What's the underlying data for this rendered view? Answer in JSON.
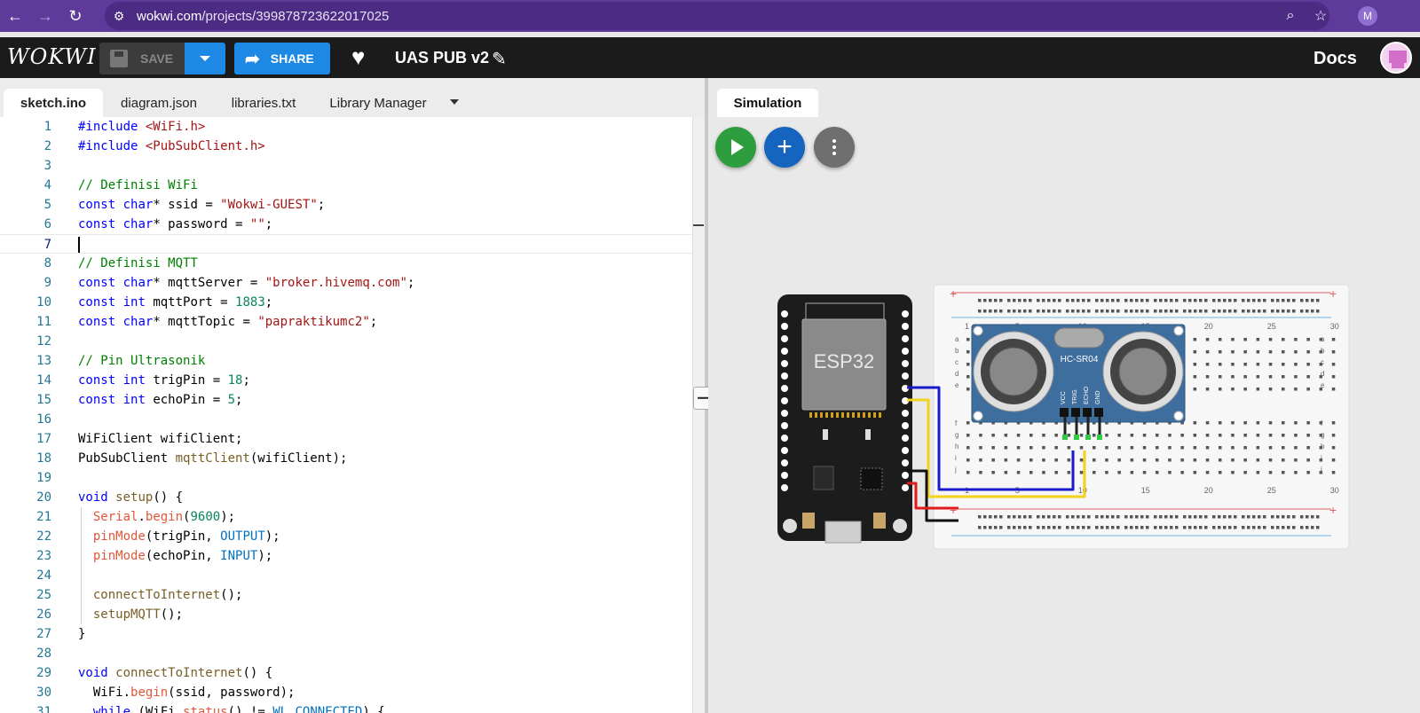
{
  "browser": {
    "url_host": "wokwi.com",
    "url_path": "/projects/399878723622017025",
    "profile_initial": "M"
  },
  "toolbar": {
    "logo": "WOKWI",
    "save_label": "SAVE",
    "share_label": "SHARE",
    "project_title": "UAS PUB v2",
    "docs_label": "Docs"
  },
  "editor": {
    "tabs": [
      {
        "label": "sketch.ino",
        "active": true
      },
      {
        "label": "diagram.json",
        "active": false
      },
      {
        "label": "libraries.txt",
        "active": false
      },
      {
        "label": "Library Manager",
        "active": false
      }
    ],
    "cursor_line": 7,
    "lines": [
      {
        "n": "1",
        "text": "#include <WiFi.h>"
      },
      {
        "n": "2",
        "text": "#include <PubSubClient.h>"
      },
      {
        "n": "3",
        "text": ""
      },
      {
        "n": "4",
        "text": "// Definisi WiFi"
      },
      {
        "n": "5",
        "text": "const char* ssid = \"Wokwi-GUEST\";"
      },
      {
        "n": "6",
        "text": "const char* password = \"\";"
      },
      {
        "n": "7",
        "text": ""
      },
      {
        "n": "8",
        "text": "// Definisi MQTT"
      },
      {
        "n": "9",
        "text": "const char* mqttServer = \"broker.hivemq.com\";"
      },
      {
        "n": "10",
        "text": "const int mqttPort = 1883;"
      },
      {
        "n": "11",
        "text": "const char* mqttTopic = \"papraktikumc2\";"
      },
      {
        "n": "12",
        "text": ""
      },
      {
        "n": "13",
        "text": "// Pin Ultrasonik"
      },
      {
        "n": "14",
        "text": "const int trigPin = 18;"
      },
      {
        "n": "15",
        "text": "const int echoPin = 5;"
      },
      {
        "n": "16",
        "text": ""
      },
      {
        "n": "17",
        "text": "WiFiClient wifiClient;"
      },
      {
        "n": "18",
        "text": "PubSubClient mqttClient(wifiClient);"
      },
      {
        "n": "19",
        "text": ""
      },
      {
        "n": "20",
        "text": "void setup() {"
      },
      {
        "n": "21",
        "text": "  Serial.begin(9600);"
      },
      {
        "n": "22",
        "text": "  pinMode(trigPin, OUTPUT);"
      },
      {
        "n": "23",
        "text": "  pinMode(echoPin, INPUT);"
      },
      {
        "n": "24",
        "text": ""
      },
      {
        "n": "25",
        "text": "  connectToInternet();"
      },
      {
        "n": "26",
        "text": "  setupMQTT();"
      },
      {
        "n": "27",
        "text": "}"
      },
      {
        "n": "28",
        "text": ""
      },
      {
        "n": "29",
        "text": "void connectToInternet() {"
      },
      {
        "n": "30",
        "text": "  WiFi.begin(ssid, password);"
      },
      {
        "n": "31",
        "text": "  while (WiFi.status() != WL_CONNECTED) {"
      }
    ]
  },
  "simulation": {
    "tab_label": "Simulation",
    "board_label": "ESP32",
    "sensor_label": "HC-SR04",
    "sensor_pins": [
      "VCC",
      "TRIG",
      "ECHO",
      "GND"
    ],
    "breadboard_cols": [
      "1",
      "5",
      "10",
      "15",
      "20",
      "25",
      "30"
    ],
    "breadboard_rows_top": [
      "a",
      "b",
      "c",
      "d",
      "e"
    ],
    "breadboard_rows_bottom": [
      "f",
      "g",
      "h",
      "i",
      "j"
    ],
    "wire_colors": {
      "blue": "#1a1acd",
      "yellow": "#f2d21b",
      "black": "#111111",
      "red": "#e01b1b",
      "green": "#2ecc40"
    }
  }
}
